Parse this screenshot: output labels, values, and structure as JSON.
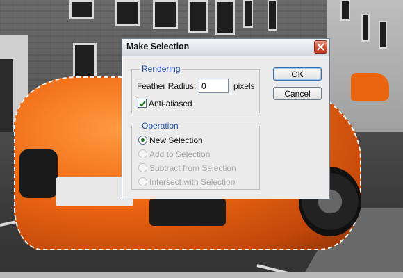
{
  "dialog": {
    "title": "Make Selection",
    "close_icon": "close-icon",
    "rendering": {
      "group_label": "Rendering",
      "feather_label": "Feather Radius:",
      "feather_value": "0",
      "feather_unit": "pixels",
      "antialias_label": "Anti-aliased",
      "antialias_checked": true
    },
    "operation": {
      "group_label": "Operation",
      "options": [
        {
          "label": "New Selection",
          "selected": true,
          "enabled": true
        },
        {
          "label": "Add to Selection",
          "selected": false,
          "enabled": false
        },
        {
          "label": "Subtract from Selection",
          "selected": false,
          "enabled": false
        },
        {
          "label": "Intersect with Selection",
          "selected": false,
          "enabled": false
        }
      ]
    },
    "buttons": {
      "ok": "OK",
      "cancel": "Cancel"
    }
  },
  "colors": {
    "group_label": "#1f4fa8",
    "close_button": "#c03a22",
    "car": "#f06a14"
  }
}
